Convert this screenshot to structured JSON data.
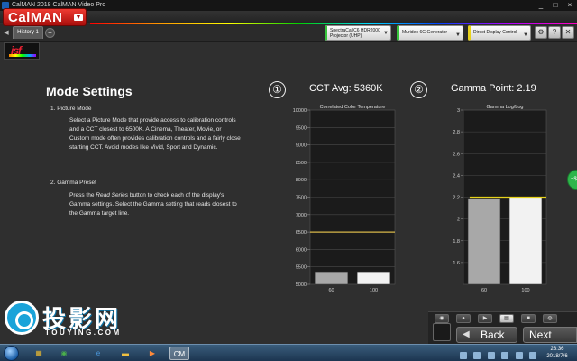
{
  "window": {
    "title": "CalMAN 2018 CalMAN Video Pro",
    "controls": [
      "_",
      "□",
      "×"
    ]
  },
  "app": {
    "logo": "CalMAN",
    "session_logo": "isf"
  },
  "toolbar": {
    "tab": "History 1",
    "tab_add": "+",
    "devices": [
      {
        "name": "SpectraCal C6 HDR2000 Projector (UHP)",
        "color": "#36c43b"
      },
      {
        "name": "Murideo 6G Generator",
        "color": "#36c43b"
      },
      {
        "name": "Direct Display Control",
        "color": "#e8d21a"
      }
    ],
    "icons": [
      "gear-icon",
      "help-icon",
      "close-icon"
    ]
  },
  "page": {
    "title": "Mode Settings",
    "steps": [
      {
        "heading": "1.  Picture Mode",
        "body": "Select a Picture Mode that provide access to calibration controls and a CCT closest to 6500K. A Cinema, Theater, Movie, or Custom mode often provides calibration controls and a fairly close starting CCT.  Avoid modes like Vivid, Sport and Dynamic."
      },
      {
        "heading": "2.  Gamma Preset",
        "body_before": "Press the ",
        "body_em": "Read Series",
        "body_after": " button to check each of the display's Gamma settings. Select the Gamma setting that reads closest to the Gamma target line."
      }
    ]
  },
  "charts": [
    {
      "number": "①",
      "heading": "CCT Avg: 5360K"
    },
    {
      "number": "②",
      "heading": "Gamma Point: 2.19"
    }
  ],
  "chart_data": [
    {
      "type": "bar",
      "title": "Correlated Color Temperature",
      "categories": [
        "60",
        "100"
      ],
      "values": [
        5360,
        5360
      ],
      "ylim": [
        5000,
        10000
      ],
      "yticks": [
        5000,
        5500,
        6000,
        6500,
        7000,
        7500,
        8000,
        8500,
        9000,
        9500,
        10000
      ],
      "target": 6500,
      "target_color": "#d8b84a",
      "bar_colors": [
        "#a8a8a8",
        "#f2f2f2"
      ],
      "grid": true
    },
    {
      "type": "bar",
      "title": "Gamma Log/Log",
      "categories": [
        "60",
        "100"
      ],
      "values": [
        2.19,
        2.2
      ],
      "ylim": [
        1.4,
        3.0
      ],
      "yticks": [
        1.6,
        1.8,
        2.0,
        2.2,
        2.4,
        2.6,
        2.8,
        3.0
      ],
      "ytick_labels": [
        "1.6",
        "1.8",
        "2",
        "2.2",
        "2.4",
        "2.6",
        "2.8",
        "3"
      ],
      "target": 2.2,
      "target_color": "#e6d21c",
      "bar_colors": [
        "#a8a8a8",
        "#f2f2f2"
      ],
      "grid": true
    }
  ],
  "navigation": {
    "back": "Back",
    "next": "Next"
  },
  "watermark": {
    "text": "投影网",
    "url": "TOUYING.COM"
  },
  "taskbar": {
    "time": "23:36",
    "date": "2018/7/6",
    "active_app": "CM"
  }
}
